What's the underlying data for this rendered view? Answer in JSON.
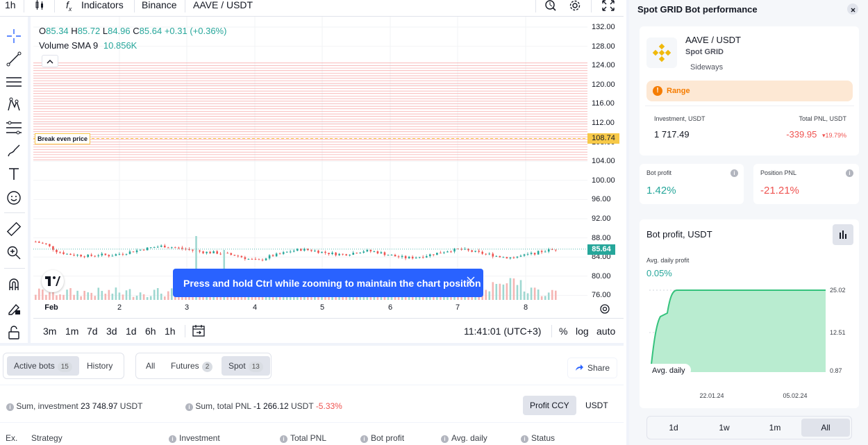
{
  "topbar": {
    "interval": "1h",
    "indicators": "Indicators",
    "exchange": "Binance",
    "pair": "AAVE / USDT"
  },
  "legend": {
    "o_label": "O",
    "o": "85.34",
    "h_label": "H",
    "h": "85.72",
    "l_label": "L",
    "l": "84.96",
    "c_label": "C",
    "c": "85.64",
    "change": "+0.31 (+0.36%)",
    "volume_label": "Volume SMA 9",
    "volume_value": "10.856K"
  },
  "chart": {
    "price_labels": [
      "132.00",
      "128.00",
      "124.00",
      "120.00",
      "116.00",
      "112.00",
      "108.00",
      "104.00",
      "100.00",
      "96.00",
      "92.00",
      "88.00",
      "84.00",
      "80.00",
      "76.00"
    ],
    "x_labels": [
      "Feb",
      "2",
      "3",
      "4",
      "5",
      "6",
      "7",
      "8"
    ],
    "break_even_label": "Break even price",
    "break_even_value": "108.74",
    "current_price": "85.64",
    "grid_top": 124.5,
    "grid_bottom": 104.3,
    "break_even": 108.74,
    "colors": {
      "up": "#26a69a",
      "down": "#ef5350",
      "grid_line": "#f7a1a1",
      "break_even_bg": "#f7c948"
    }
  },
  "toast": {
    "message": "Press and hold Ctrl while zooming to maintain the chart position"
  },
  "bottombar": {
    "ranges": [
      "3m",
      "1m",
      "7d",
      "3d",
      "1d",
      "6h",
      "1h"
    ],
    "time": "11:41:01 (UTC+3)",
    "percent": "%",
    "log": "log",
    "auto": "auto"
  },
  "bots": {
    "active_label": "Active bots",
    "active_count": "15",
    "history_label": "History",
    "filter_all": "All",
    "filter_futures": "Futures",
    "futures_count": "2",
    "filter_spot": "Spot",
    "spot_count": "13",
    "share": "Share",
    "sum_investment_label": "Sum, investment",
    "sum_investment_value": "23 748.97",
    "sum_investment_ccy": "USDT",
    "sum_pnl_label": "Sum, total PNL",
    "sum_pnl_value": "-1 266.12",
    "sum_pnl_ccy": "USDT",
    "sum_pnl_pct": "-5.33%",
    "profit_ccy": "Profit CCY",
    "usdt": "USDT",
    "columns": [
      "Ex.",
      "Strategy",
      "Investment",
      "Total PNL",
      "Bot profit",
      "Avg. daily",
      "Status"
    ]
  },
  "panel": {
    "title": "Spot GRID Bot performance",
    "pair": "AAVE / USDT",
    "strategy": "Spot GRID",
    "mode": "Sideways",
    "range_label": "Range",
    "investment_label": "Investment, USDT",
    "investment_value": "1 717.49",
    "total_pnl_label": "Total PNL, USDT",
    "total_pnl_value": "-339.95",
    "total_pnl_pct": "19.79%",
    "bot_profit_label": "Bot profit",
    "bot_profit_value": "1.42%",
    "position_pnl_label": "Position PNL",
    "position_pnl_value": "-21.21%",
    "profit_chart_title": "Bot profit, USDT",
    "avg_daily_label": "Avg. daily profit",
    "avg_daily_value": "0.05%",
    "chart_y_labels": [
      "25.02",
      "12.51",
      "0.87"
    ],
    "chart_x_labels": [
      "22.01.24",
      "05.02.24"
    ],
    "avg_daily_tag": "Avg. daily",
    "periods": [
      "1d",
      "1w",
      "1m",
      "All"
    ],
    "active_period": "All"
  }
}
